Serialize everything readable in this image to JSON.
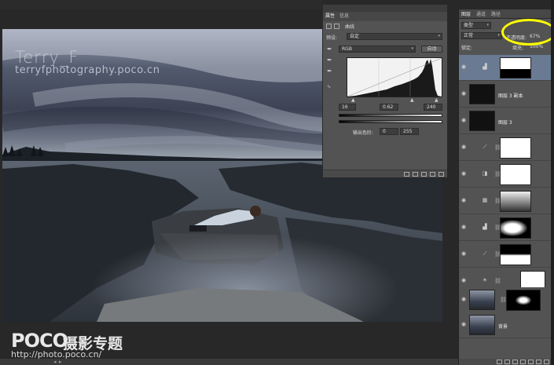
{
  "app": "Photoshop",
  "canvas": {
    "watermark_title": "Terry_F",
    "watermark_url": "terryfphotography.poco.cn",
    "poco_logo": "POCO",
    "poco_title": "摄影专题",
    "poco_url": "http://photo.poco.cn/"
  },
  "properties_panel": {
    "tabs": [
      "属性",
      "信息"
    ],
    "adjustment_title": "曲线",
    "preset_label": "预设:",
    "preset_value": "自定",
    "channel_value": "RGB",
    "auto_button": "自动",
    "input_black": "16",
    "input_gamma": "0.62",
    "input_white": "240",
    "output_label": "输出色阶:",
    "output_black": "0",
    "output_white": "255"
  },
  "layers_panel": {
    "tabs": [
      "图层",
      "通道",
      "路径"
    ],
    "filter_kind": "类型",
    "blend_mode": "正常",
    "opacity_label": "不透明度:",
    "opacity_value": "67%",
    "lock_label": "锁定:",
    "fill_label": "填充:",
    "fill_value": "100%",
    "highlight_color": "#ffff00",
    "layers": [
      {
        "name": "",
        "selected": true
      },
      {
        "name": "图层 3 副本",
        "selected": false
      },
      {
        "name": "图层 3",
        "selected": false
      },
      {
        "name": "",
        "selected": false
      },
      {
        "name": "",
        "selected": false
      },
      {
        "name": "",
        "selected": false
      },
      {
        "name": "",
        "selected": false
      },
      {
        "name": "",
        "selected": false
      },
      {
        "name": "",
        "selected": false
      },
      {
        "name": "",
        "selected": false
      },
      {
        "name": "背景",
        "selected": false
      }
    ]
  }
}
